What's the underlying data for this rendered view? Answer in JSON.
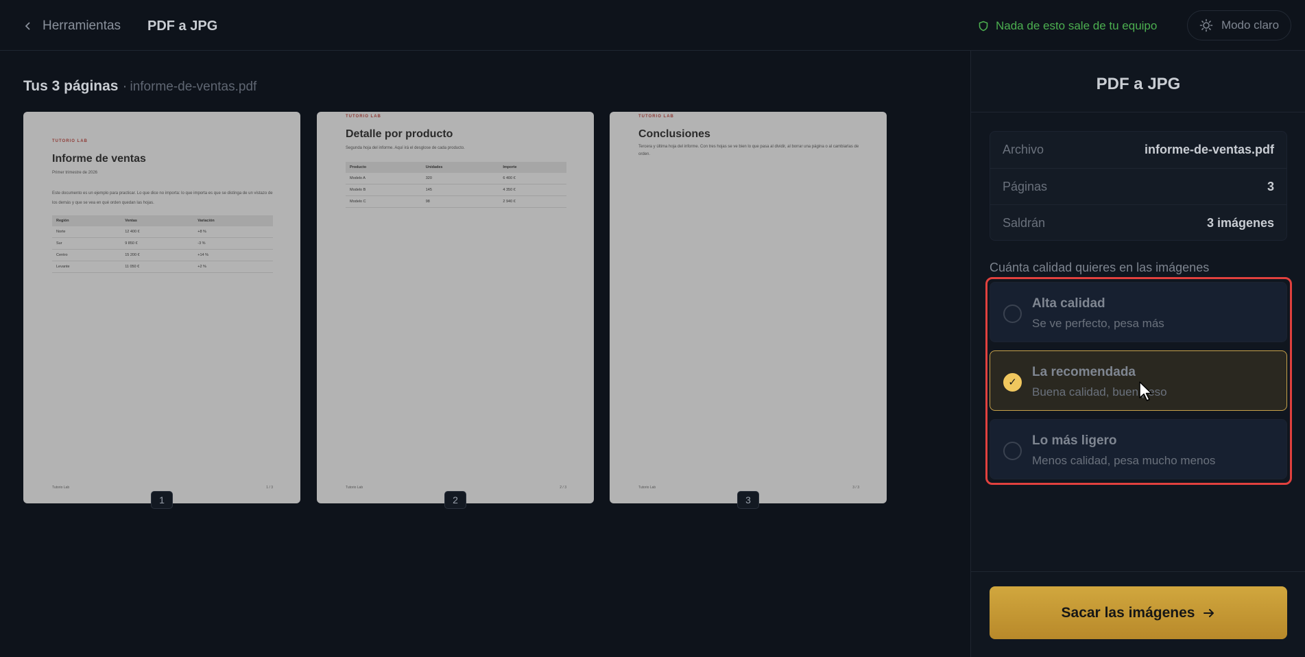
{
  "topbar": {
    "back_label": "Herramientas",
    "title": "PDF a JPG",
    "privacy_text": "Nada de esto sale de tu equipo",
    "mode_label": "Modo claro"
  },
  "main": {
    "heading": "Tus 3 páginas",
    "separator": "·",
    "filename": "informe-de-ventas.pdf",
    "pages": [
      {
        "number": "1",
        "brand": "TUTORIO LAB",
        "title": "Informe de ventas",
        "subtitle": "Primer trimestre de 2026",
        "body": "Este documento es un ejemplo para practicar. Lo que dice no importa: lo que importa es que se distinga de un vistazo de los demás y que se vea en qué orden quedan las hojas.",
        "table": {
          "headers": [
            "Región",
            "Ventas",
            "Variación"
          ],
          "rows": [
            [
              "Norte",
              "12 400 €",
              "+8 %"
            ],
            [
              "Sur",
              "9 850 €",
              "-3 %"
            ],
            [
              "Centro",
              "15 200 €",
              "+14 %"
            ],
            [
              "Levante",
              "11 050 €",
              "+2 %"
            ]
          ]
        },
        "footer_left": "Tutorio Lab",
        "footer_right": "1 / 3"
      },
      {
        "number": "2",
        "brand": "TUTORIO LAB",
        "title": "Detalle por producto",
        "subtitle": "Segunda hoja del informe. Aquí irá el desglose de cada producto.",
        "table": {
          "headers": [
            "Producto",
            "Unidades",
            "Importe"
          ],
          "rows": [
            [
              "Modelo A",
              "320",
              "6 400 €"
            ],
            [
              "Modelo B",
              "145",
              "4 350 €"
            ],
            [
              "Modelo C",
              "98",
              "2 940 €"
            ]
          ]
        },
        "footer_left": "Tutorio Lab",
        "footer_right": "2 / 3"
      },
      {
        "number": "3",
        "brand": "TUTORIO LAB",
        "title": "Conclusiones",
        "subtitle": "Tercera y última hoja del informe. Con tres hojas se ve bien lo que pasa al dividir, al borrar una página o al cambiarlas de orden.",
        "footer_left": "Tutorio Lab",
        "footer_right": "3 / 3"
      }
    ]
  },
  "sidebar": {
    "title": "PDF a JPG",
    "info": [
      {
        "key": "Archivo",
        "value": "informe-de-ventas.pdf"
      },
      {
        "key": "Páginas",
        "value": "3"
      },
      {
        "key": "Saldrán",
        "value": "3 imágenes"
      }
    ],
    "quality_label": "Cuánta calidad quieres en las imágenes",
    "options": [
      {
        "title": "Alta calidad",
        "subtitle": "Se ve perfecto, pesa más",
        "selected": false
      },
      {
        "title": "La recomendada",
        "subtitle": "Buena calidad, buen peso",
        "selected": true
      },
      {
        "title": "Lo más ligero",
        "subtitle": "Menos calidad, pesa mucho menos",
        "selected": false
      }
    ],
    "check_glyph": "✓",
    "cta_label": "Sacar las imágenes"
  },
  "colors": {
    "background": "#0e131b",
    "accent": "#d1a73e",
    "privacy_green": "#4caf50",
    "highlight_red": "#e1413e"
  },
  "icons": [
    "chevron-left-icon",
    "shield-icon",
    "sun-icon",
    "check-icon",
    "arrow-right-icon",
    "cursor-icon"
  ]
}
